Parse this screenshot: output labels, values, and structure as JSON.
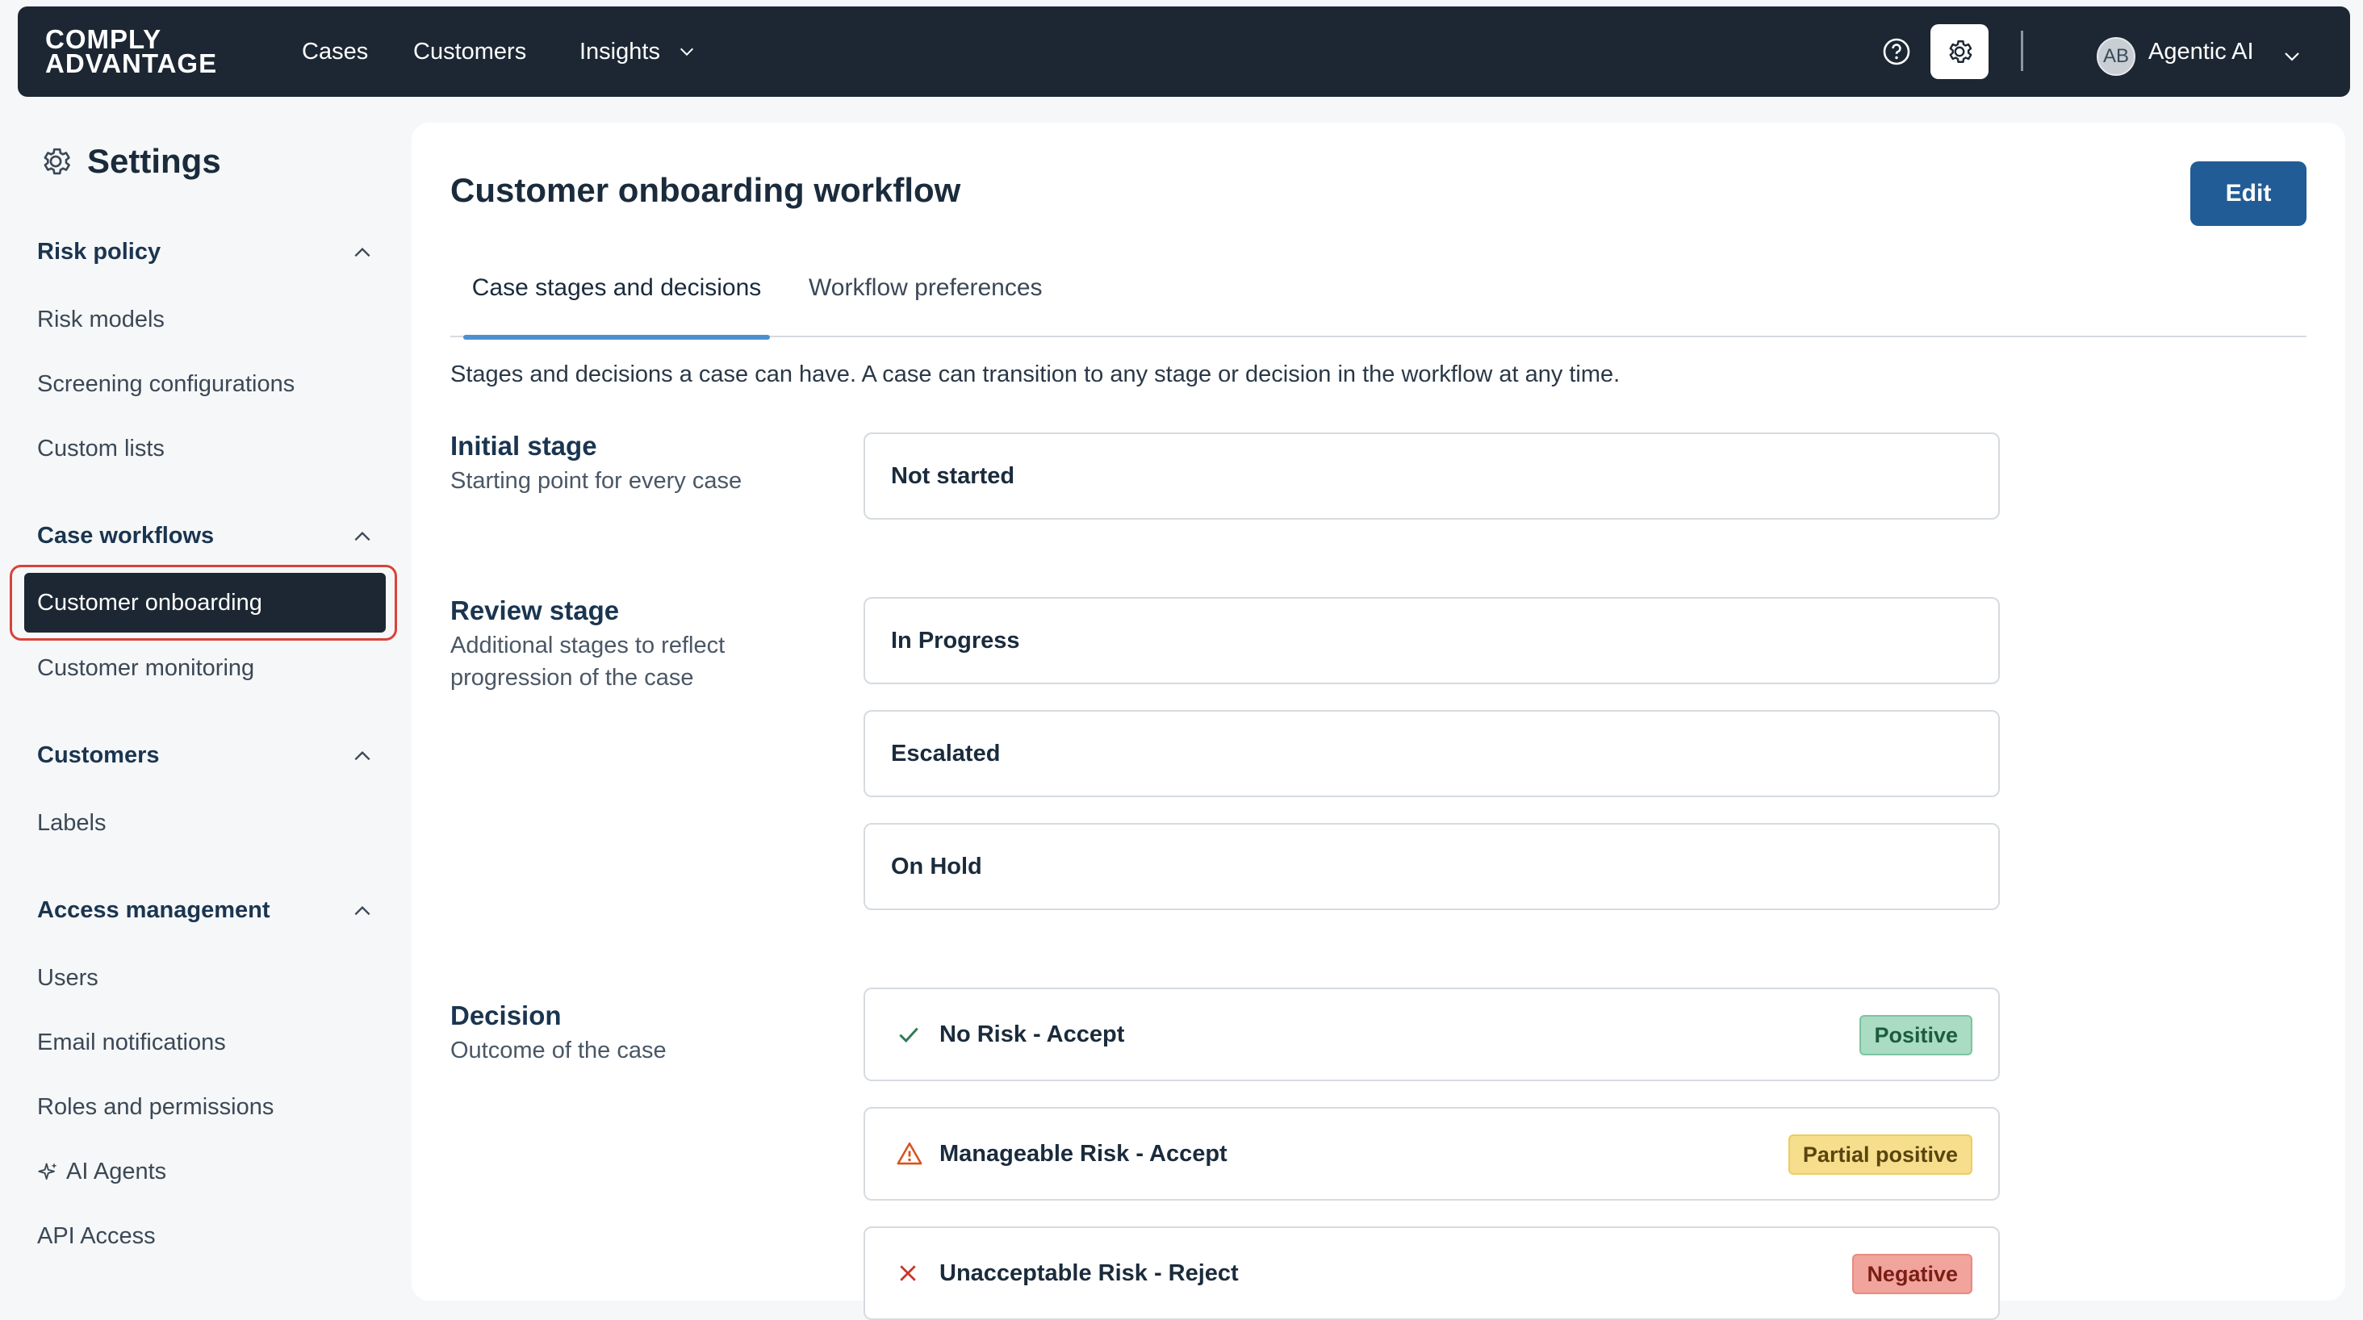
{
  "header": {
    "logo_line1": "COMPLY",
    "logo_line2": "ADVANTAGE",
    "nav": [
      "Cases",
      "Customers",
      "Insights"
    ],
    "user_initials": "AB",
    "user_name": "Agentic AI"
  },
  "sidebar": {
    "title": "Settings",
    "sections": [
      {
        "label": "Risk policy",
        "items": [
          "Risk models",
          "Screening configurations",
          "Custom lists"
        ]
      },
      {
        "label": "Case workflows",
        "items": [
          "Customer onboarding",
          "Customer monitoring"
        ]
      },
      {
        "label": "Customers",
        "items": [
          "Labels"
        ]
      },
      {
        "label": "Access management",
        "items": [
          "Users",
          "Email notifications",
          "Roles and permissions",
          "AI Agents",
          "API Access"
        ]
      }
    ],
    "active_item": "Customer onboarding"
  },
  "main": {
    "title": "Customer onboarding workflow",
    "edit_label": "Edit",
    "tabs": [
      "Case stages and decisions",
      "Workflow preferences"
    ],
    "active_tab": "Case stages and decisions",
    "intro": "Stages and decisions a case can have. A case can transition to any stage or decision in the workflow at any time.",
    "initial_stage": {
      "title": "Initial stage",
      "description": "Starting point for every case",
      "stages": [
        "Not started"
      ]
    },
    "review_stage": {
      "title": "Review stage",
      "description": "Additional stages to reflect progression of the case",
      "stages": [
        "In Progress",
        "Escalated",
        "On Hold"
      ]
    },
    "decision": {
      "title": "Decision",
      "description": "Outcome of the case",
      "items": [
        {
          "label": "No Risk - Accept",
          "badge": "Positive",
          "icon": "check-icon",
          "color": "#2f7a55"
        },
        {
          "label": "Manageable Risk - Accept",
          "badge": "Partial positive",
          "icon": "warning-icon",
          "color": "#d9531e"
        },
        {
          "label": "Unacceptable Risk - Reject",
          "badge": "Negative",
          "icon": "close-icon",
          "color": "#c7362b"
        }
      ]
    }
  },
  "colors": {
    "topbar": "#1c2733",
    "primary": "#215c96",
    "active_tab": "#4f8fd0",
    "focus_ring": "#d9423a"
  }
}
